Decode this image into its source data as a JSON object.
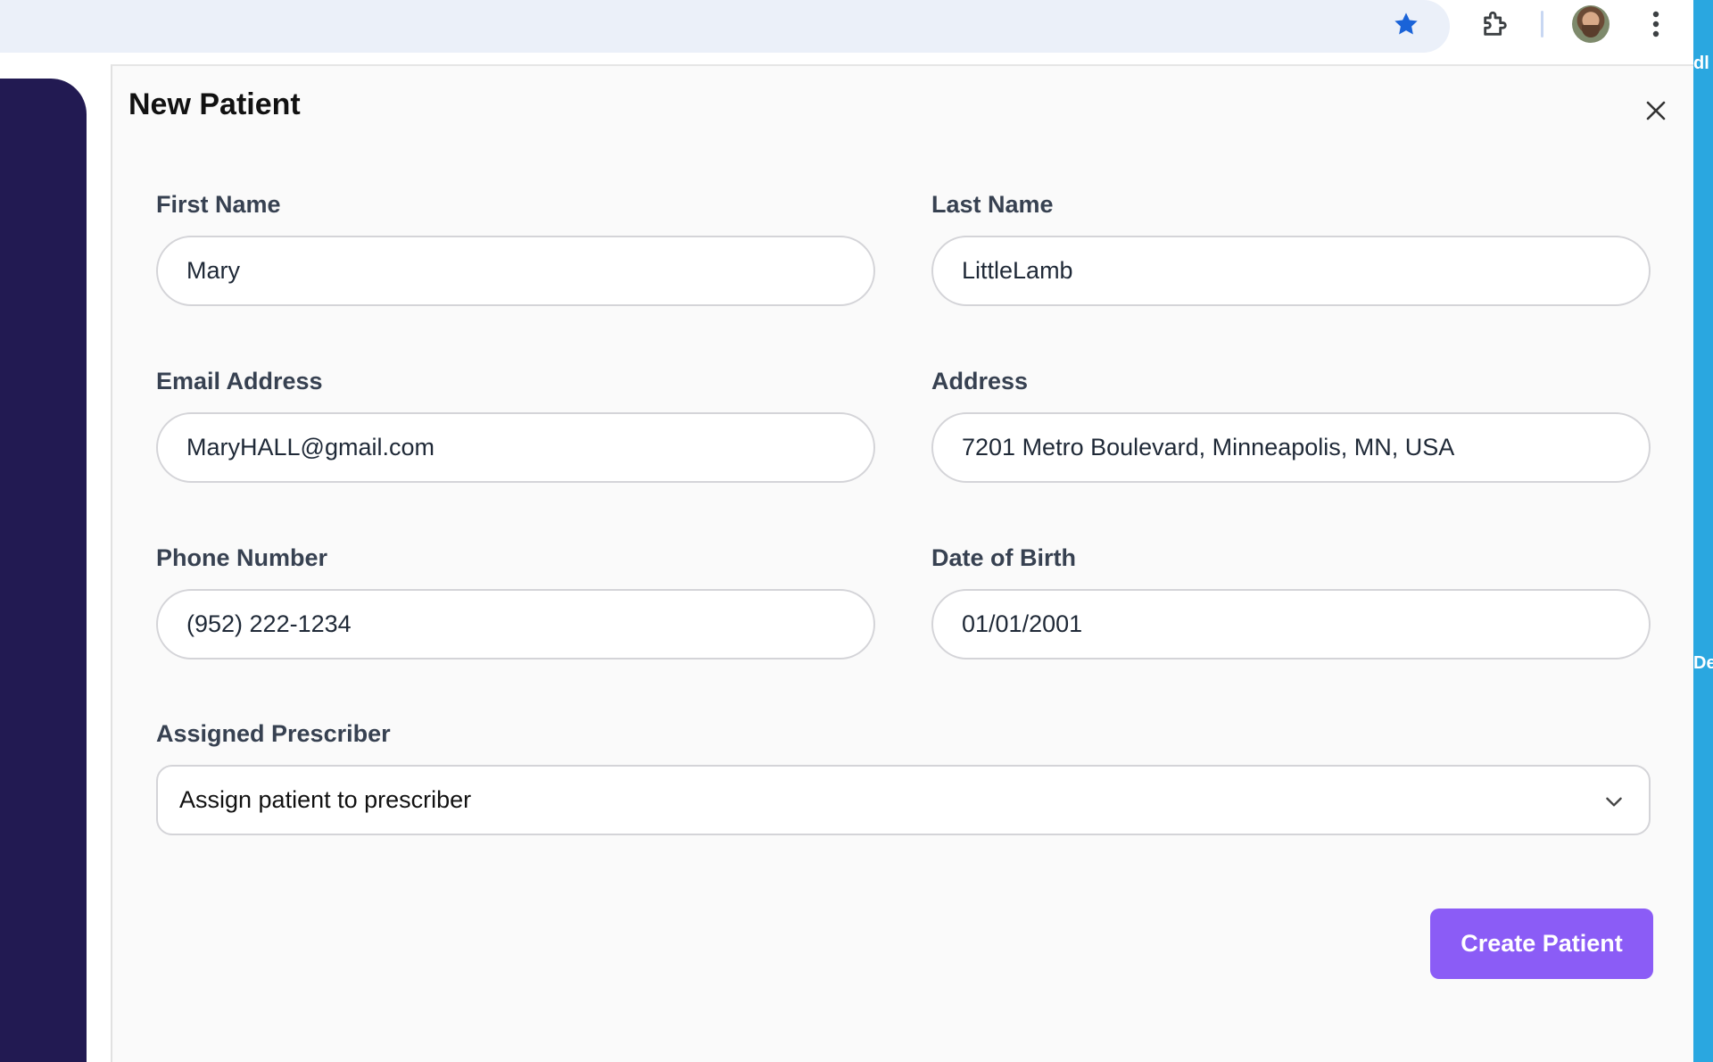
{
  "browser": {
    "bookmark_icon": "star-icon",
    "extensions_icon": "puzzle-icon",
    "menu_icon": "kebab-icon",
    "accent_color": "#1a63d8"
  },
  "background_edge": {
    "text_top": "dl",
    "text_mid": "De"
  },
  "modal": {
    "title": "New Patient",
    "close_icon": "close-icon",
    "fields": {
      "first_name": {
        "label": "First Name",
        "value": "Mary"
      },
      "last_name": {
        "label": "Last Name",
        "value": "LittleLamb"
      },
      "email": {
        "label": "Email Address",
        "value": "MaryHALL@gmail.com"
      },
      "address": {
        "label": "Address",
        "value": "7201 Metro Boulevard, Minneapolis, MN, USA"
      },
      "phone": {
        "label": "Phone Number",
        "value": "(952) 222-1234"
      },
      "dob": {
        "label": "Date of Birth",
        "value": "01/01/2001"
      }
    },
    "prescriber": {
      "label": "Assigned Prescriber",
      "selected": "Assign patient to prescriber",
      "chevron_icon": "chevron-down-icon"
    },
    "submit_label": "Create Patient",
    "submit_color": "#8b5cf6"
  },
  "sidebar_color": "#221a52"
}
